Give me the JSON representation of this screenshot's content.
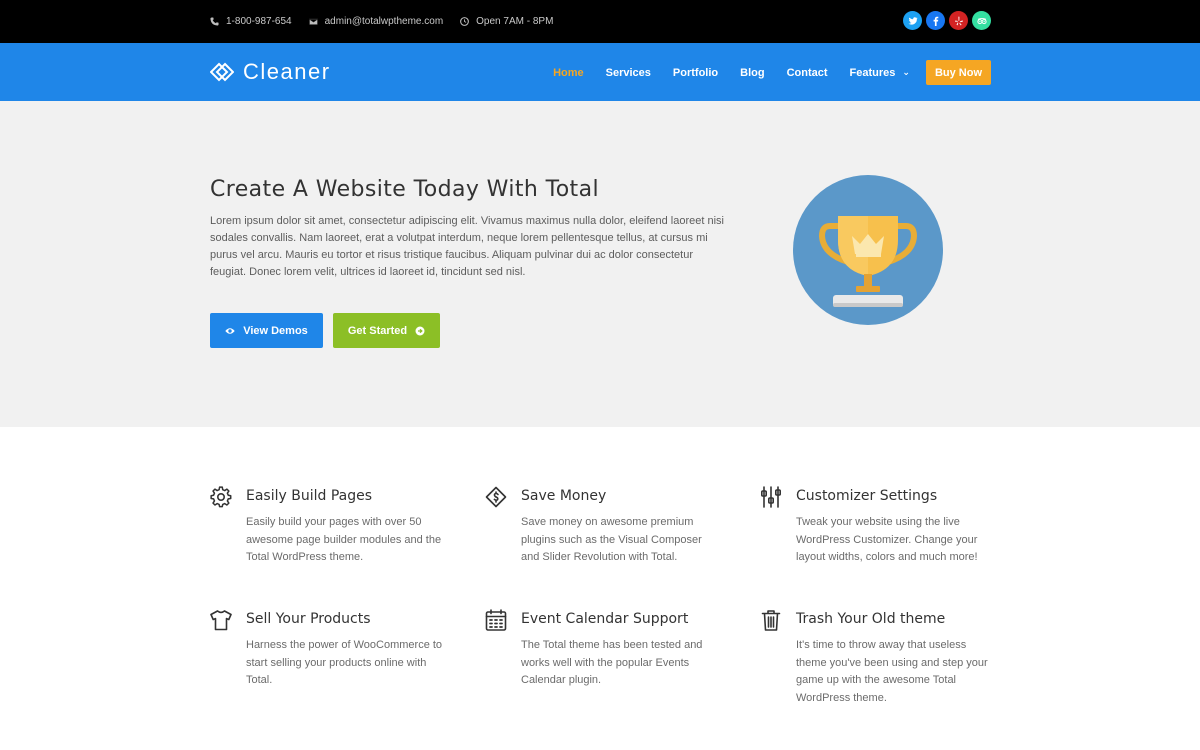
{
  "topbar": {
    "phone": "1-800-987-654",
    "email": "admin@totalwptheme.com",
    "hours": "Open 7AM - 8PM",
    "socials": [
      {
        "name": "twitter-icon",
        "color": "#1da1f2"
      },
      {
        "name": "facebook-icon",
        "color": "#1877f2"
      },
      {
        "name": "yelp-icon",
        "color": "#d32323"
      },
      {
        "name": "tripadvisor-icon",
        "color": "#34e0a1"
      }
    ]
  },
  "header": {
    "logo_text": "Cleaner",
    "nav": [
      "Home",
      "Services",
      "Portfolio",
      "Blog",
      "Contact",
      "Features"
    ],
    "active": "Home",
    "cta": "Buy Now"
  },
  "hero": {
    "title": "Create A Website Today With Total",
    "text": "Lorem ipsum dolor sit amet, consectetur adipiscing elit. Vivamus maximus nulla dolor, eleifend laoreet nisi sodales convallis. Nam laoreet, erat a volutpat interdum, neque lorem pellentesque tellus, at cursus mi purus vel arcu. Mauris eu tortor et risus tristique faucibus. Aliquam pulvinar dui ac dolor consectetur feugiat. Donec lorem velit, ultrices id laoreet id, tincidunt sed nisl.",
    "btn_demos": "View Demos",
    "btn_start": "Get Started"
  },
  "colors": {
    "brand_blue": "#1f86e8",
    "accent_orange": "#f5a623",
    "accent_green": "#8cbf26"
  },
  "features": [
    {
      "icon": "gear-icon",
      "title": "Easily Build Pages",
      "desc": "Easily build your pages with over 50 awesome page builder modules and the Total WordPress theme."
    },
    {
      "icon": "money-icon",
      "title": "Save Money",
      "desc": "Save money on awesome premium plugins such as the Visual Composer and Slider Revolution with Total."
    },
    {
      "icon": "sliders-icon",
      "title": "Customizer Settings",
      "desc": "Tweak your website using the live WordPress Customizer. Change your layout widths, colors and much more!"
    },
    {
      "icon": "shirt-icon",
      "title": "Sell Your Products",
      "desc": "Harness the power of WooCommerce to start selling your products online with Total."
    },
    {
      "icon": "calendar-icon",
      "title": "Event Calendar Support",
      "desc": "The Total theme has been tested and works well with the popular Events Calendar plugin."
    },
    {
      "icon": "trash-icon",
      "title": "Trash Your Old theme",
      "desc": "It's time to throw away that useless theme you've been using and step your game up with the awesome Total WordPress theme."
    }
  ]
}
